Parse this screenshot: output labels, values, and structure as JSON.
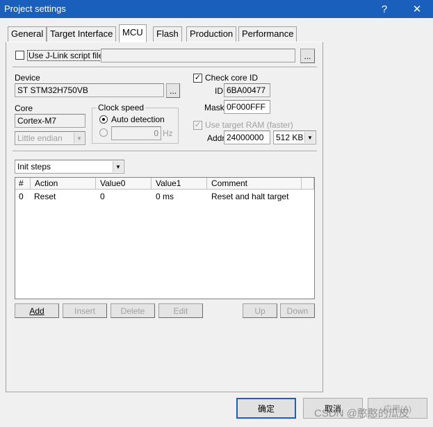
{
  "window": {
    "title": "Project settings",
    "help_label": "?",
    "close_label": "✕"
  },
  "tabs": [
    {
      "label": "General"
    },
    {
      "label": "Target Interface"
    },
    {
      "label": "MCU"
    },
    {
      "label": "Flash"
    },
    {
      "label": "Production"
    },
    {
      "label": "Performance"
    }
  ],
  "script": {
    "label": "Use J-Link script file",
    "checked": false,
    "path": "",
    "browse_label": "..."
  },
  "device": {
    "label": "Device",
    "value": "ST STM32H750VB",
    "browse_label": "..."
  },
  "core": {
    "label": "Core",
    "value": "Cortex-M7",
    "endian": "Little endian"
  },
  "clock": {
    "label": "Clock speed",
    "auto_label": "Auto detection",
    "value": "0",
    "unit": "Hz"
  },
  "core_id": {
    "check_label": "Check core ID",
    "checked": true,
    "id_label": "ID",
    "id_value": "6BA00477",
    "mask_label": "Mask",
    "mask_value": "0F000FFF"
  },
  "ram": {
    "label": "Use target RAM (faster)",
    "checked": true,
    "addr_label": "Addr",
    "addr_value": "24000000",
    "size": "512 KB"
  },
  "steps": {
    "select": "Init steps"
  },
  "table": {
    "headers": [
      "#",
      "Action",
      "Value0",
      "Value1",
      "Comment"
    ],
    "rows": [
      {
        "num": "0",
        "action": "Reset",
        "v0": "0",
        "v1": "0 ms",
        "comment": "Reset and halt target"
      }
    ]
  },
  "step_buttons": {
    "add": "Add",
    "insert": "Insert",
    "delete": "Delete",
    "edit": "Edit",
    "up": "Up",
    "down": "Down"
  },
  "dialog_buttons": {
    "ok": "确定",
    "cancel": "取消",
    "apply": "应用(A)"
  },
  "watermark": "CSDN @憨憨的瓜皮"
}
